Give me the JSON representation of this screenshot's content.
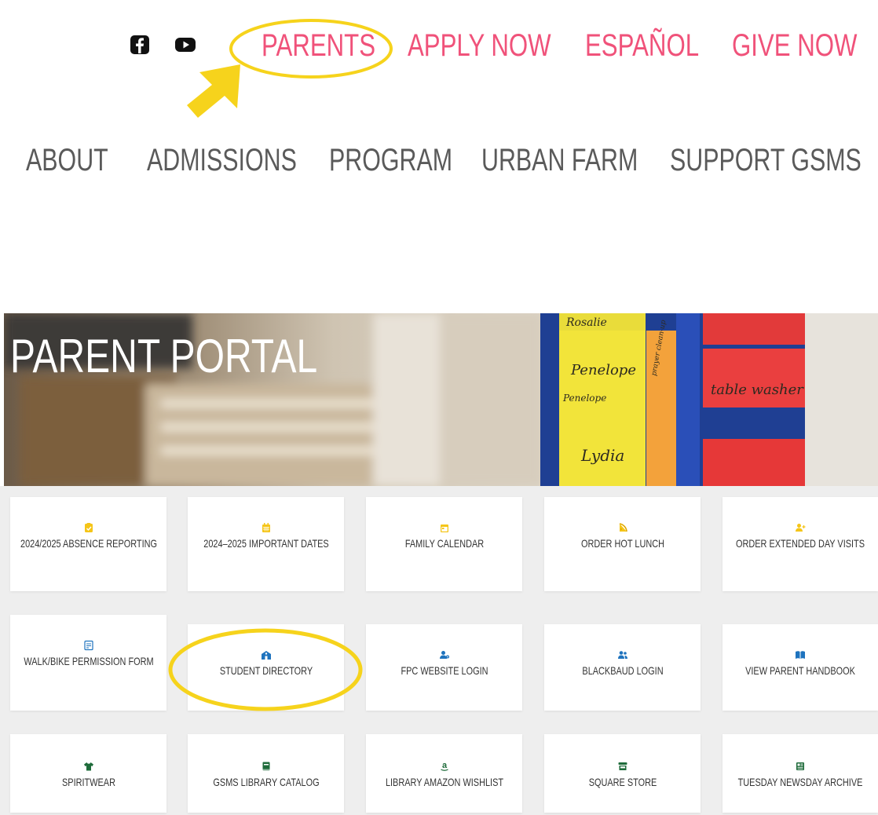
{
  "top_nav": {
    "social": [
      "facebook-icon",
      "youtube-icon"
    ],
    "links": [
      "PARENTS",
      "APPLY NOW",
      "ESPAÑOL",
      "GIVE NOW"
    ]
  },
  "main_nav": [
    "ABOUT",
    "ADMISSIONS",
    "PROGRAM",
    "URBAN FARM",
    "SUPPORT GSMS"
  ],
  "hero": {
    "title": "PARENT PORTAL",
    "board_names": [
      "Rosalie",
      "Penelope",
      "Penelope",
      "Lydia",
      "table washer",
      "prayer clean-up"
    ]
  },
  "tiles": [
    {
      "label": "2024/2025 ABSENCE REPORTING",
      "icon": "clipboard-check-icon",
      "icon_color": "#f5c518"
    },
    {
      "label": "2024–2025 IMPORTANT DATES",
      "icon": "calendar-icon",
      "icon_color": "#f5c518"
    },
    {
      "label": "FAMILY CALENDAR",
      "icon": "calendar-day-icon",
      "icon_color": "#f5c518"
    },
    {
      "label": "ORDER HOT LUNCH",
      "icon": "pizza-icon",
      "icon_color": "#f5c518"
    },
    {
      "label": "ORDER EXTENDED DAY VISITS",
      "icon": "user-plus-icon",
      "icon_color": "#f5c518"
    },
    {
      "label": "WALK/BIKE PERMISSION FORM",
      "icon": "form-icon",
      "icon_color": "#1e73be"
    },
    {
      "label": "STUDENT DIRECTORY",
      "icon": "school-icon",
      "icon_color": "#1e73be"
    },
    {
      "label": "FPC WEBSITE LOGIN",
      "icon": "user-cog-icon",
      "icon_color": "#1e73be"
    },
    {
      "label": "BLACKBAUD LOGIN",
      "icon": "users-icon",
      "icon_color": "#1e73be"
    },
    {
      "label": "VIEW PARENT HANDBOOK",
      "icon": "book-open-icon",
      "icon_color": "#1e73be"
    },
    {
      "label": "SPIRITWEAR",
      "icon": "tshirt-icon",
      "icon_color": "#1e6b3a"
    },
    {
      "label": "GSMS LIBRARY CATALOG",
      "icon": "book-icon",
      "icon_color": "#1e6b3a"
    },
    {
      "label": "LIBRARY AMAZON WISHLIST",
      "icon": "amazon-icon",
      "icon_color": "#1e6b3a"
    },
    {
      "label": "SQUARE STORE",
      "icon": "store-icon",
      "icon_color": "#1e6b3a"
    },
    {
      "label": "TUESDAY NEWSDAY ARCHIVE",
      "icon": "newspaper-icon",
      "icon_color": "#1e6b3a"
    }
  ],
  "colors": {
    "accent_pink": "#f0527a",
    "annotation_yellow": "#f6d31c",
    "nav_gray": "#5a5a5a"
  }
}
